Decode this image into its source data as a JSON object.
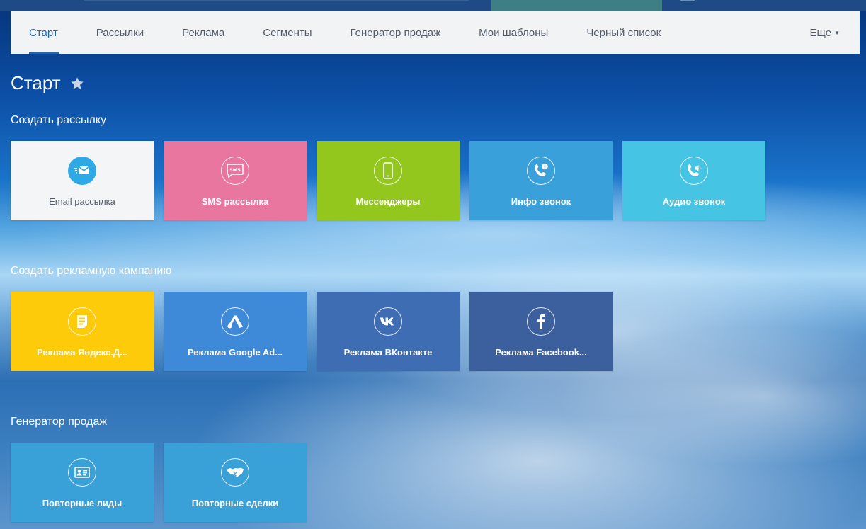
{
  "nav": {
    "items": [
      "Старт",
      "Рассылки",
      "Реклама",
      "Сегменты",
      "Генератор продаж",
      "Мои шаблоны",
      "Черный список"
    ],
    "more": "Еще"
  },
  "page": {
    "title": "Старт"
  },
  "sections": {
    "mailing": {
      "title": "Создать рассылку",
      "tiles": [
        {
          "label": "Email рассылка",
          "icon": "email-icon",
          "color": "#f3f5f7"
        },
        {
          "label": "SMS рассылка",
          "icon": "sms-icon",
          "color": "#e9769e"
        },
        {
          "label": "Мессенджеры",
          "icon": "smartphone-icon",
          "color": "#93c71d"
        },
        {
          "label": "Инфо звонок",
          "icon": "info-call-icon",
          "color": "#3aa0da"
        },
        {
          "label": "Аудио звонок",
          "icon": "audio-call-icon",
          "color": "#45c5e3"
        }
      ]
    },
    "ads": {
      "title": "Создать рекламную кампанию",
      "tiles": [
        {
          "label": "Реклама Яндекс.Д...",
          "icon": "yandex-direct-icon",
          "color": "#fecb0a"
        },
        {
          "label": "Реклама Google Ad...",
          "icon": "google-ads-icon",
          "color": "#3f8ad8"
        },
        {
          "label": "Реклама ВКонтакте",
          "icon": "vk-icon",
          "color": "#3e6db3"
        },
        {
          "label": "Реклама Facebook...",
          "icon": "facebook-icon",
          "color": "#3c5f9e"
        }
      ]
    },
    "sales": {
      "title": "Генератор продаж",
      "tiles": [
        {
          "label": "Повторные лиды",
          "icon": "contact-card-icon",
          "color": "#3aa1d8"
        },
        {
          "label": "Повторные сделки",
          "icon": "handshake-icon",
          "color": "#3aa1d8"
        }
      ]
    }
  }
}
